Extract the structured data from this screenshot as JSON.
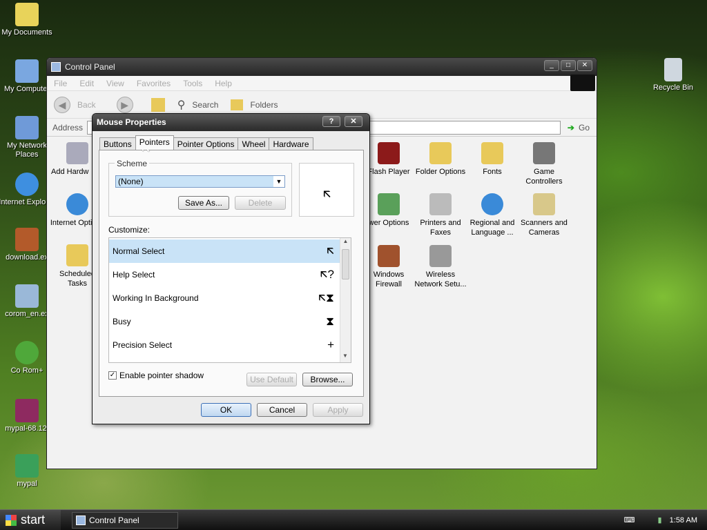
{
  "desktop": {
    "icons": [
      {
        "label": "My Documents",
        "icon": "folder-icon",
        "color": "#e8d35a"
      },
      {
        "label": "My Computer",
        "icon": "computer-icon",
        "color": "#7aa7e0"
      },
      {
        "label": "My Network Places",
        "icon": "network-icon",
        "color": "#6f9ad8"
      },
      {
        "label": "Internet Explorer",
        "icon": "ie-icon",
        "color": "#3e8fe0"
      },
      {
        "label": "download.ex",
        "icon": "archive-icon",
        "color": "#b35a2a"
      },
      {
        "label": "corom_en.ex",
        "icon": "installer-icon",
        "color": "#9ab8d8"
      },
      {
        "label": "Co Rom+",
        "icon": "corom-icon",
        "color": "#4fa83a"
      },
      {
        "label": "mypal-68.12.",
        "icon": "archive-icon",
        "color": "#8e2a60"
      },
      {
        "label": "mypal",
        "icon": "mypal-icon",
        "color": "#3aa05a"
      },
      {
        "label": "Recycle Bin",
        "icon": "recycle-bin-icon",
        "color": "#cfd7df"
      }
    ]
  },
  "control_panel": {
    "title": "Control Panel",
    "menu": [
      "File",
      "Edit",
      "View",
      "Favorites",
      "Tools",
      "Help"
    ],
    "toolbar": {
      "back": "Back",
      "search": "Search",
      "folders": "Folders"
    },
    "address_label": "Address",
    "go": "Go",
    "items_left": [
      {
        "label": "Add Hardw",
        "icon": "add-hardware-icon"
      },
      {
        "label": "Internet Options",
        "icon": "internet-options-icon"
      },
      {
        "label": "Scheduled Tasks",
        "icon": "scheduled-tasks-icon"
      }
    ],
    "items": [
      {
        "label": "Flash Player",
        "icon": "flash-icon",
        "color": "#8c1a1a"
      },
      {
        "label": "Folder Options",
        "icon": "folder-options-icon",
        "color": "#e8c95a"
      },
      {
        "label": "Fonts",
        "icon": "fonts-icon",
        "color": "#e8c95a"
      },
      {
        "label": "Game Controllers",
        "icon": "gamepad-icon",
        "color": "#777777"
      },
      {
        "label": "wer Options",
        "icon": "power-icon",
        "color": "#5aa05a"
      },
      {
        "label": "Printers and Faxes",
        "icon": "printer-icon",
        "color": "#bbbbbb"
      },
      {
        "label": "Regional and Language ...",
        "icon": "globe-icon",
        "color": "#3a8ad8"
      },
      {
        "label": "Scanners and Cameras",
        "icon": "scanner-icon",
        "color": "#d8c88a"
      },
      {
        "label": "Windows Firewall",
        "icon": "firewall-icon",
        "color": "#a0522d"
      },
      {
        "label": "Wireless Network Setu...",
        "icon": "wireless-icon",
        "color": "#999999"
      }
    ]
  },
  "dialog": {
    "title": "Mouse Properties",
    "tabs": [
      "Buttons",
      "Pointers",
      "Pointer Options",
      "Wheel",
      "Hardware"
    ],
    "active_tab": "Pointers",
    "scheme_label": "Scheme",
    "scheme_value": "(None)",
    "save_as": "Save As...",
    "delete": "Delete",
    "customize_label": "Customize:",
    "rows": [
      {
        "label": "Normal Select",
        "cursor": "🡬"
      },
      {
        "label": "Help Select",
        "cursor": "🡬?"
      },
      {
        "label": "Working In Background",
        "cursor": "🡬⧗"
      },
      {
        "label": "Busy",
        "cursor": "⧗"
      },
      {
        "label": "Precision Select",
        "cursor": "+"
      }
    ],
    "shadow_label": "Enable pointer shadow",
    "use_default": "Use Default",
    "browse": "Browse...",
    "ok": "OK",
    "cancel": "Cancel",
    "apply": "Apply"
  },
  "taskbar": {
    "start": "start",
    "task": "Control Panel",
    "clock": "1:58 AM"
  }
}
